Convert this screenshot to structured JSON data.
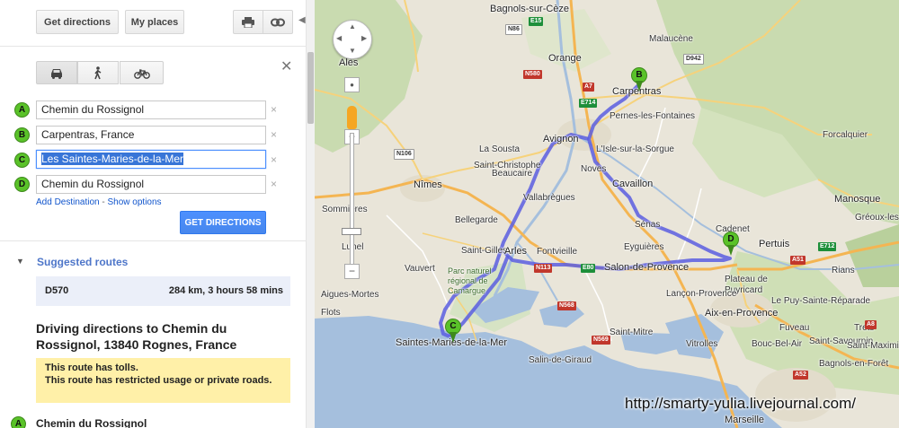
{
  "toolbar": {
    "get_directions": "Get directions",
    "my_places": "My places",
    "print_icon": "printer-icon",
    "link_icon": "link-icon"
  },
  "travel_modes": [
    "car-icon",
    "walk-icon",
    "bike-icon"
  ],
  "waypoints": [
    {
      "marker": "A",
      "value": "Chemin du Rossignol"
    },
    {
      "marker": "B",
      "value": "Carpentras, France"
    },
    {
      "marker": "C",
      "value": "Les Saintes-Maries-de-la-Mer"
    },
    {
      "marker": "D",
      "value": "Chemin du Rossignol"
    }
  ],
  "links": {
    "add_destination": "Add Destination",
    "separator": "-",
    "show_options": "Show options"
  },
  "go_button": "GET DIRECTIONS",
  "suggested": {
    "title": "Suggested routes",
    "routes": [
      {
        "name": "D570",
        "info": "284 km, 3 hours 58 mins"
      }
    ]
  },
  "directions": {
    "title": "Driving directions to Chemin du Rossignol, 13840 Rognes, France",
    "warnings": [
      "This route has tolls.",
      "This route has restricted usage or private roads."
    ],
    "first_step_marker": "A",
    "first_step": "Chemin du Rossignol"
  },
  "map": {
    "places": [
      {
        "name": "Bagnols-sur-Cèze",
        "big": true
      },
      {
        "name": "Malaucène"
      },
      {
        "name": "Alès",
        "big": true
      },
      {
        "name": "Orange",
        "big": true
      },
      {
        "name": "Carpentras",
        "big": true
      },
      {
        "name": "Pernes-les-Fontaines"
      },
      {
        "name": "Avignon",
        "big": true
      },
      {
        "name": "L'Isle-sur-la-Sorgue"
      },
      {
        "name": "Forcalquier"
      },
      {
        "name": "Nîmes",
        "big": true
      },
      {
        "name": "Beaucaire"
      },
      {
        "name": "Noves"
      },
      {
        "name": "Cavaillon",
        "big": true
      },
      {
        "name": "Sommières"
      },
      {
        "name": "Bellegarde"
      },
      {
        "name": "Fontvieille"
      },
      {
        "name": "Sénas"
      },
      {
        "name": "Cadenet"
      },
      {
        "name": "Manosque",
        "big": true
      },
      {
        "name": "Gréoux-les-Bains"
      },
      {
        "name": "Vauvert"
      },
      {
        "name": "Saint-Gilles"
      },
      {
        "name": "Arles",
        "big": true
      },
      {
        "name": "Eyguières"
      },
      {
        "name": "Pertuis"
      },
      {
        "name": "Salon-de-Provence",
        "big": true
      },
      {
        "name": "Plateau de Puyricard"
      },
      {
        "name": "Aigues-Mortes"
      },
      {
        "name": "Parc naturel régional de Camargue"
      },
      {
        "name": "Aix-en-Provence",
        "big": true
      },
      {
        "name": "Saintes-Maries-de-la-Mer",
        "big": true
      },
      {
        "name": "Salin-de-Giraud"
      },
      {
        "name": "Saint-Mitre"
      },
      {
        "name": "Vitrolles"
      },
      {
        "name": "Saint-Savournin"
      },
      {
        "name": "Bouc-Bel-Air"
      },
      {
        "name": "Marseille",
        "big": true
      },
      {
        "name": "Bagnols-en-Forêt"
      },
      {
        "name": "Lunel"
      },
      {
        "name": "Flots"
      },
      {
        "name": "La Sousta"
      },
      {
        "name": "Saint-Christophe"
      },
      {
        "name": "Vallabrègues"
      },
      {
        "name": "Lançon-Provence"
      },
      {
        "name": "Rians"
      },
      {
        "name": "Fuveau"
      },
      {
        "name": "Trets"
      },
      {
        "name": "Saint-Maximin"
      },
      {
        "name": "Le Puy-Sainte-Réparade"
      }
    ],
    "road_shields": [
      {
        "code": "E15",
        "color": "g"
      },
      {
        "code": "N86",
        "color": "w"
      },
      {
        "code": "N580",
        "color": "r"
      },
      {
        "code": "A7",
        "color": "r"
      },
      {
        "code": "E714",
        "color": "g"
      },
      {
        "code": "D942",
        "color": "w"
      },
      {
        "code": "N106",
        "color": "w"
      },
      {
        "code": "E712",
        "color": "g"
      },
      {
        "code": "A51",
        "color": "r"
      },
      {
        "code": "N113",
        "color": "r"
      },
      {
        "code": "E80",
        "color": "g"
      },
      {
        "code": "N568",
        "color": "r"
      },
      {
        "code": "N569",
        "color": "r"
      },
      {
        "code": "A52",
        "color": "r"
      },
      {
        "code": "A8",
        "color": "r"
      }
    ],
    "markers": [
      "B",
      "C",
      "D"
    ]
  },
  "watermark": "http://smarty-yulia.livejournal.com/"
}
